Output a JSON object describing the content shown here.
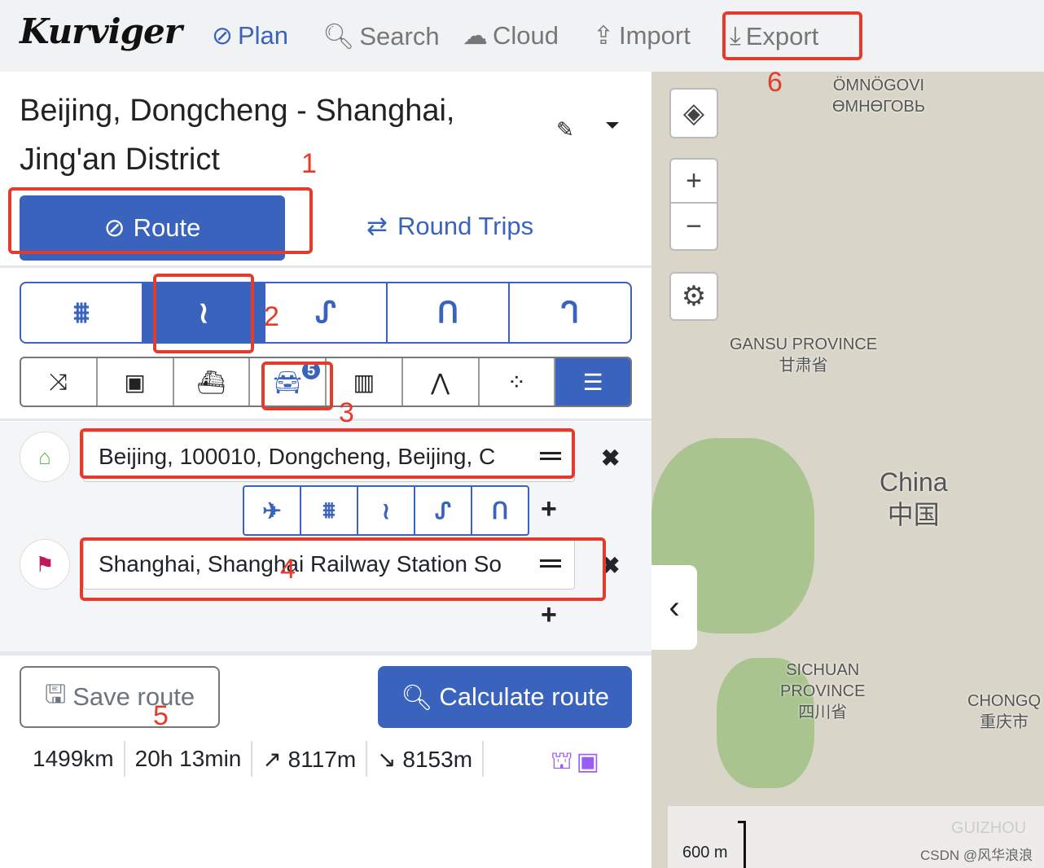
{
  "header": {
    "logo": "Kurviger",
    "nav": [
      {
        "label": "Plan",
        "icon": "compass-icon"
      },
      {
        "label": "Search",
        "icon": "search-icon"
      },
      {
        "label": "Cloud",
        "icon": "cloud-icon"
      },
      {
        "label": "Import",
        "icon": "upload-icon"
      },
      {
        "label": "Export",
        "icon": "download-icon"
      }
    ]
  },
  "route": {
    "title": "Beijing, Dongcheng - Shanghai, Jing'an District",
    "tabs": {
      "route": "Route",
      "round_trips": "Round Trips"
    }
  },
  "profiles": [
    "motorway",
    "curvy",
    "curvier",
    "extra-curvy",
    "curviest"
  ],
  "profile_selected": "curvy",
  "options": [
    "shuffle",
    "toll",
    "ferry",
    "car",
    "tunnel",
    "narrow-road",
    "unpaved",
    "settings"
  ],
  "options_badge": "5",
  "waypoints": [
    {
      "value": "Beijing, 100010, Dongcheng, Beijing, C",
      "icon": "home-icon"
    },
    {
      "value": "Shanghai, Shanghai Railway Station So",
      "icon": "flag-icon"
    }
  ],
  "actions": {
    "save": "Save route",
    "calculate": "Calculate route"
  },
  "stats": {
    "distance": "1499km",
    "duration": "20h 13min",
    "ascent": "↗ 8117m",
    "descent": "↘ 8153m"
  },
  "map": {
    "labels": [
      "ÖMNÖGOVI",
      "ӨМНӨГОВЬ",
      "GANSU PROVINCE",
      "甘肃省",
      "China",
      "中国",
      "SICHUAN",
      "PROVINCE",
      "四川省",
      "CHONGQ",
      "重庆市",
      "GUIZHOU"
    ],
    "scale": "600 m",
    "watermark": "CSDN @风华浪浪"
  },
  "annotations": [
    "1",
    "2",
    "3",
    "4",
    "5",
    "6"
  ],
  "colors": {
    "accent": "#3a63bd",
    "annotation": "#e53b2c",
    "warning": "#9b5cf5"
  }
}
